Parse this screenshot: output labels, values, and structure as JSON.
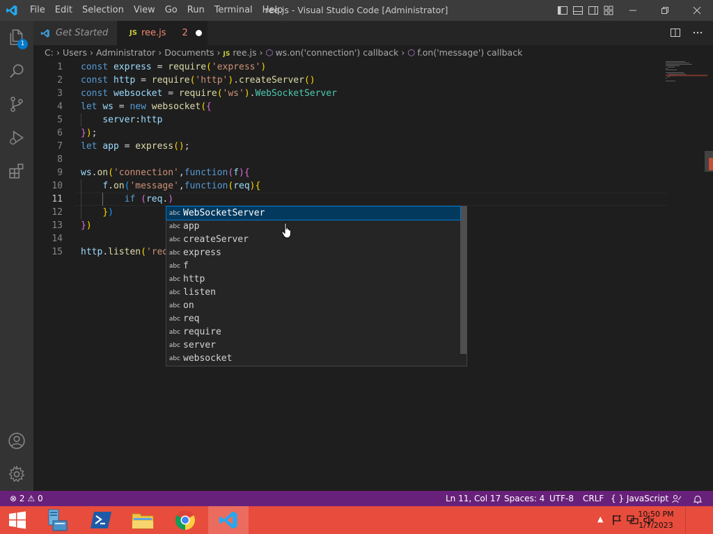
{
  "window": {
    "title": "ree.js - Visual Studio Code [Administrator]",
    "menu": [
      "File",
      "Edit",
      "Selection",
      "View",
      "Go",
      "Run",
      "Terminal",
      "Help"
    ]
  },
  "activity_bar": {
    "explorer_badge": "1",
    "items": [
      "files-icon",
      "search-icon",
      "source-control-icon",
      "run-debug-icon",
      "extensions-icon",
      "accounts-icon",
      "manage-gear-icon"
    ]
  },
  "tabs": [
    {
      "label": "Get Started",
      "active": false
    },
    {
      "label": "ree.js",
      "lang_badge": "JS",
      "problems": "2",
      "dirty": true,
      "active": true
    }
  ],
  "breadcrumbs": {
    "path": [
      "C:",
      "Users",
      "Administrator",
      "Documents"
    ],
    "file_badge": "JS",
    "file": "ree.js",
    "symbol1": "ws.on('connection') callback",
    "symbol2": "f.on('message') callback"
  },
  "editor": {
    "line_numbers": [
      "1",
      "2",
      "3",
      "4",
      "5",
      "6",
      "7",
      "8",
      "9",
      "10",
      "11",
      "12",
      "13",
      "14",
      "15"
    ],
    "current_line": "11",
    "lines": [
      "const express = require('express')",
      "const http = require('http').createServer()",
      "const websocket = require('ws').WebSocketServer",
      "let ws = new websocket({",
      "    server:http",
      "});",
      "let app = express();",
      "",
      "ws.on('connection',function(f){",
      "    f.on('message',function(req){",
      "        if (req.)",
      "    })",
      "})",
      "",
      "http.listen('req"
    ]
  },
  "suggest": {
    "kind_label": "abc",
    "items": [
      "WebSocketServer",
      "app",
      "createServer",
      "express",
      "f",
      "http",
      "listen",
      "on",
      "req",
      "require",
      "server",
      "websocket"
    ],
    "selected_index": 0
  },
  "status_bar": {
    "errors": "2",
    "warnings": "0",
    "position": "Ln 11, Col 17",
    "indent": "Spaces: 4",
    "encoding": "UTF-8",
    "eol": "CRLF",
    "language_braces": "{ }",
    "language": "JavaScript"
  },
  "taskbar": {
    "apps": [
      "server-manager-icon",
      "powershell-icon",
      "file-explorer-icon",
      "chrome-icon",
      "vscode-icon"
    ],
    "time": "10:50 PM",
    "date": "1/7/2023"
  },
  "colors": {
    "status_bar": "#68217a",
    "taskbar": "#e74c3c",
    "selection": "#04395e",
    "accent": "#007acc"
  }
}
